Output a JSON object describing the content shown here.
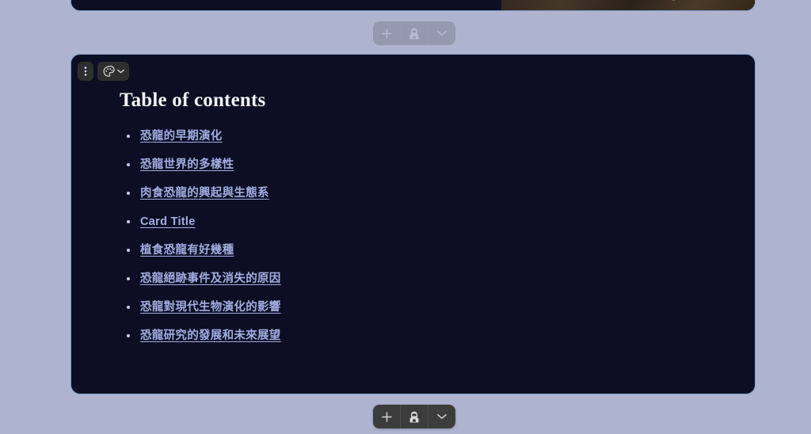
{
  "canvas": {
    "background_color": "#aeb4d0"
  },
  "card_above": {
    "name": "previous-card",
    "background_color": "#0c0f24",
    "border_color": "#7e9cc8",
    "image_region_color": "#3a2e22"
  },
  "toolbar_ghost": {
    "add_label": "+",
    "assistant_icon": "astronaut-icon",
    "expand_icon": "chevron-down-icon"
  },
  "toolbar_bottom": {
    "add_label": "+",
    "assistant_icon": "astronaut-icon",
    "expand_icon": "chevron-down-icon"
  },
  "card": {
    "background_color": "#0c0f24",
    "border_color": "#7e9cc8",
    "tools": {
      "menu_icon": "more-vertical-icon",
      "theme_icon": "palette-icon",
      "theme_chevron_icon": "chevron-down-icon"
    },
    "title": "Table of contents",
    "link_color": "#a3ade0",
    "items": [
      {
        "label": "恐龍的早期演化"
      },
      {
        "label": "恐龍世界的多樣性"
      },
      {
        "label": "肉食恐龍的興起與生態系"
      },
      {
        "label": "Card Title"
      },
      {
        "label": "植食恐龍有好幾種"
      },
      {
        "label": "恐龍絕跡事件及消失的原因"
      },
      {
        "label": "恐龍對現代生物演化的影響"
      },
      {
        "label": "恐龍研究的發展和未來展望"
      }
    ]
  }
}
